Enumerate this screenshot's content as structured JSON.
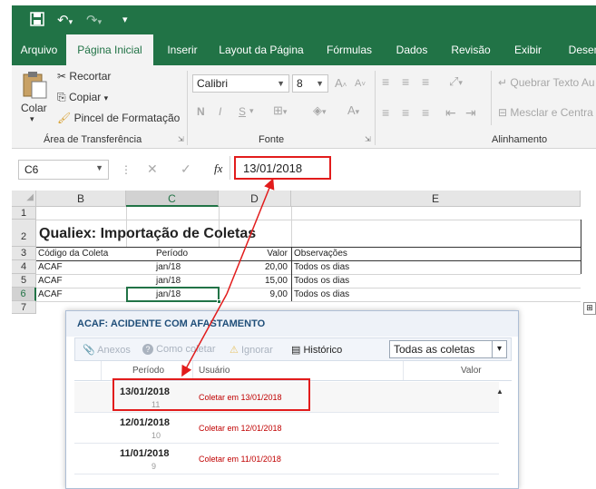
{
  "titlebar": {
    "save_icon": "save-icon",
    "undo_icon": "undo-icon",
    "redo_icon": "redo-icon",
    "customize_icon": "customize-qat-icon"
  },
  "tabs": [
    "Arquivo",
    "Página Inicial",
    "Inserir",
    "Layout da Página",
    "Fórmulas",
    "Dados",
    "Revisão",
    "Exibir",
    "Desenv"
  ],
  "ribbon": {
    "clipboard": {
      "paste": "Colar",
      "cut": "Recortar",
      "copy": "Copiar",
      "format_painter": "Pincel de Formatação",
      "group_label": "Área de Transferência"
    },
    "font": {
      "font_name": "Calibri",
      "font_size": "8",
      "bold": "N",
      "italic": "I",
      "underline": "S",
      "group_label": "Fonte"
    },
    "alignment": {
      "wrap_text": "Quebrar Texto Au",
      "merge_center": "Mesclar e Centra",
      "group_label": "Alinhamento"
    }
  },
  "formula_bar": {
    "name_box": "C6",
    "fx": "fx",
    "formula": "13/01/2018"
  },
  "sheet": {
    "columns": [
      "B",
      "C",
      "D",
      "E"
    ],
    "rows": [
      "1",
      "2",
      "3",
      "4",
      "5",
      "6",
      "7"
    ],
    "title": "Qualiex: Importação de Coletas",
    "headers": [
      "Código da Coleta",
      "Período",
      "Valor",
      "Observações"
    ],
    "data": [
      [
        "ACAF",
        "jan/18",
        "20,00",
        "Todos os dias"
      ],
      [
        "ACAF",
        "jan/18",
        "15,00",
        "Todos os dias"
      ],
      [
        "ACAF",
        "jan/18",
        "9,00",
        "Todos os dias"
      ]
    ]
  },
  "dialog": {
    "title": "ACAF: ACIDENTE COM AFASTAMENTO",
    "toolbar": {
      "attachments": "Anexos",
      "how_to_collect": "Como coletar",
      "ignore": "Ignorar",
      "history": "Histórico",
      "filter": "Todas as coletas"
    },
    "columns": [
      "Período",
      "Usuário",
      "Valor"
    ],
    "rows": [
      {
        "date": "13/01/2018",
        "num": "11",
        "user": "Coletar em 13/01/2018"
      },
      {
        "date": "12/01/2018",
        "num": "10",
        "user": "Coletar em 12/01/2018"
      },
      {
        "date": "11/01/2018",
        "num": "9",
        "user": "Coletar em 11/01/2018"
      }
    ]
  },
  "colors": {
    "excel_green": "#217346",
    "highlight_red": "#e21c1c",
    "dialog_title": "#1f4e79"
  }
}
